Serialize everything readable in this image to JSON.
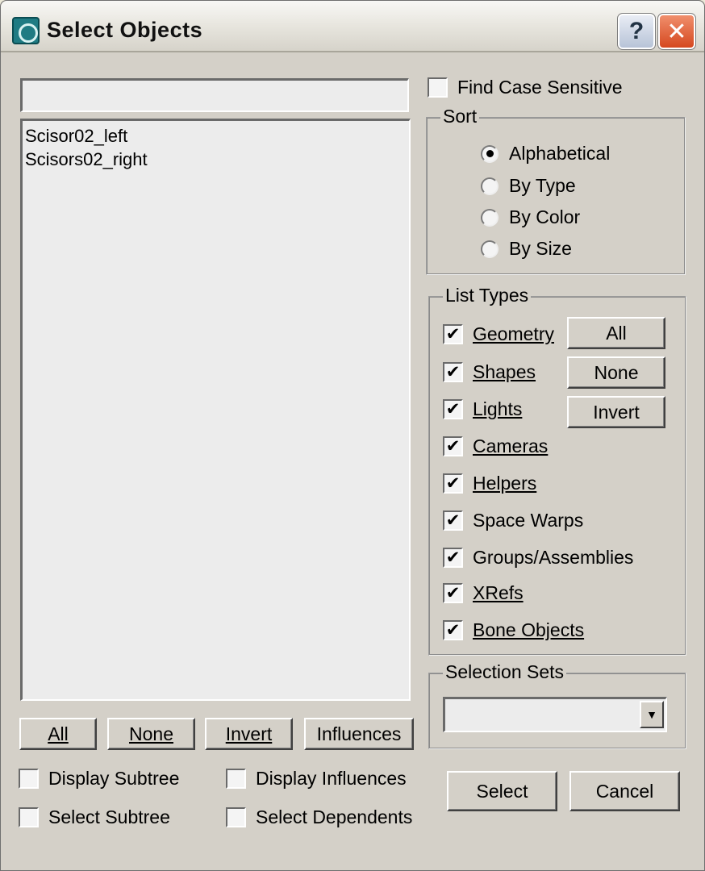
{
  "window": {
    "title": "Select Objects",
    "help_label": "?",
    "close_label": "✕"
  },
  "search": {
    "value": ""
  },
  "objects": [
    "Scisor02_left",
    "Scisors02_right"
  ],
  "list_buttons": [
    "All",
    "None",
    "Invert",
    "Influences"
  ],
  "options": [
    {
      "label": "Display Subtree",
      "checked": false
    },
    {
      "label": "Display Influences",
      "checked": false
    },
    {
      "label": "Select Subtree",
      "checked": false
    },
    {
      "label": "Select Dependents",
      "checked": false
    }
  ],
  "find_case": {
    "label": "Find Case Sensitive",
    "checked": false
  },
  "sort": {
    "legend": "Sort",
    "options": [
      "Alphabetical",
      "By Type",
      "By Color",
      "By Size"
    ],
    "selected": "Alphabetical"
  },
  "list_types": {
    "legend": "List Types",
    "items": [
      {
        "label": "Geometry",
        "checked": true
      },
      {
        "label": "Shapes",
        "checked": true
      },
      {
        "label": "Lights",
        "checked": true
      },
      {
        "label": "Cameras",
        "checked": true
      },
      {
        "label": "Helpers",
        "checked": true
      },
      {
        "label": "Space Warps",
        "checked": true
      },
      {
        "label": "Groups/Assemblies",
        "checked": true
      },
      {
        "label": "XRefs",
        "checked": true
      },
      {
        "label": "Bone Objects",
        "checked": true
      }
    ],
    "buttons": [
      "All",
      "None",
      "Invert"
    ]
  },
  "selection_sets": {
    "legend": "Selection Sets",
    "value": "",
    "arrow": "▼"
  },
  "actions": {
    "select": "Select",
    "cancel": "Cancel"
  },
  "check_mark": "✔"
}
